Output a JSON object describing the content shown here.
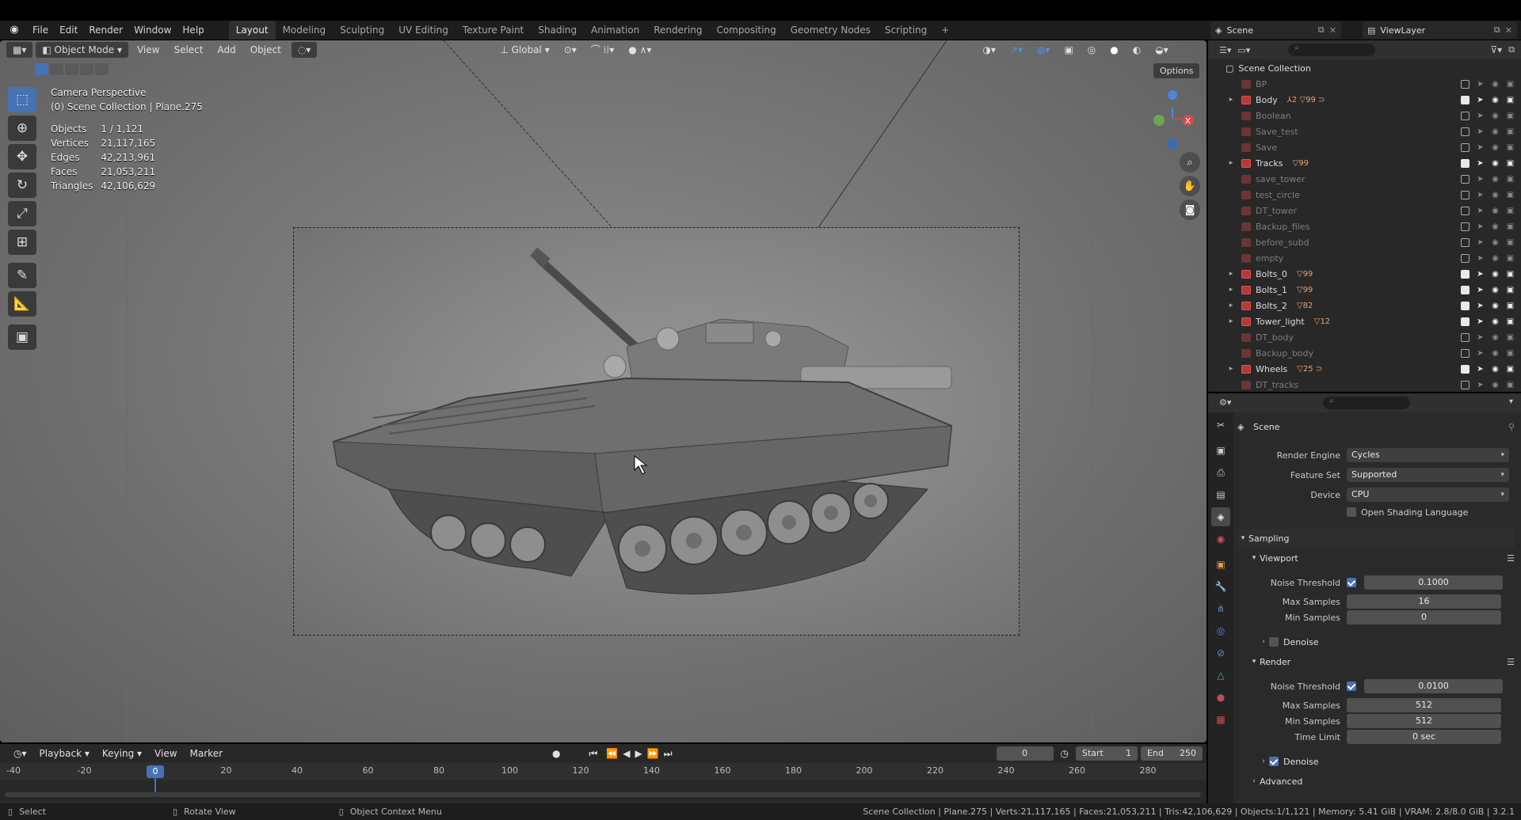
{
  "menubar": {
    "menus": [
      "File",
      "Edit",
      "Render",
      "Window",
      "Help"
    ],
    "workspaces": [
      "Layout",
      "Modeling",
      "Sculpting",
      "UV Editing",
      "Texture Paint",
      "Shading",
      "Animation",
      "Rendering",
      "Compositing",
      "Geometry Nodes",
      "Scripting"
    ],
    "active_workspace": "Layout",
    "add_tab": "+",
    "scene": "Scene",
    "view_layer": "ViewLayer"
  },
  "viewport_header": {
    "mode": "Object Mode",
    "menus": [
      "View",
      "Select",
      "Add",
      "Object"
    ],
    "orientation": "Global",
    "options": "Options"
  },
  "viewport": {
    "view_name": "Camera Perspective",
    "context": "(0) Scene Collection | Plane.275",
    "stats": [
      {
        "label": "Objects",
        "value": "1 / 1,121"
      },
      {
        "label": "Vertices",
        "value": "21,117,165"
      },
      {
        "label": "Edges",
        "value": "42,213,961"
      },
      {
        "label": "Faces",
        "value": "21,053,211"
      },
      {
        "label": "Triangles",
        "value": "42,106,629"
      }
    ]
  },
  "outliner": {
    "root": "Scene Collection",
    "items": [
      {
        "name": "BP",
        "expandable": false,
        "enabled": false,
        "mods": ""
      },
      {
        "name": "Body",
        "expandable": true,
        "enabled": true,
        "mods": "⅄2 ▽99 ⊃"
      },
      {
        "name": "Boolean",
        "expandable": false,
        "enabled": false,
        "mods": ""
      },
      {
        "name": "Save_test",
        "expandable": false,
        "enabled": false,
        "mods": ""
      },
      {
        "name": "Save",
        "expandable": false,
        "enabled": false,
        "mods": ""
      },
      {
        "name": "Tracks",
        "expandable": true,
        "enabled": true,
        "mods": "▽99"
      },
      {
        "name": "save_tower",
        "expandable": false,
        "enabled": false,
        "mods": ""
      },
      {
        "name": "test_circle",
        "expandable": false,
        "enabled": false,
        "mods": ""
      },
      {
        "name": "DT_tower",
        "expandable": false,
        "enabled": false,
        "mods": ""
      },
      {
        "name": "Backup_files",
        "expandable": false,
        "enabled": false,
        "mods": ""
      },
      {
        "name": "before_subd",
        "expandable": false,
        "enabled": false,
        "mods": ""
      },
      {
        "name": "empty",
        "expandable": false,
        "enabled": false,
        "mods": ""
      },
      {
        "name": "Bolts_0",
        "expandable": true,
        "enabled": true,
        "mods": "▽99"
      },
      {
        "name": "Bolts_1",
        "expandable": true,
        "enabled": true,
        "mods": "▽99"
      },
      {
        "name": "Bolts_2",
        "expandable": true,
        "enabled": true,
        "mods": "▽82"
      },
      {
        "name": "Tower_light",
        "expandable": true,
        "enabled": true,
        "mods": "▽12"
      },
      {
        "name": "DT_body",
        "expandable": false,
        "enabled": false,
        "mods": ""
      },
      {
        "name": "Backup_body",
        "expandable": false,
        "enabled": false,
        "mods": ""
      },
      {
        "name": "Wheels",
        "expandable": true,
        "enabled": true,
        "mods": "▽25 ⊃"
      },
      {
        "name": "DT_tracks",
        "expandable": false,
        "enabled": false,
        "mods": ""
      }
    ]
  },
  "properties": {
    "context": "Scene",
    "render_engine": {
      "label": "Render Engine",
      "value": "Cycles"
    },
    "feature_set": {
      "label": "Feature Set",
      "value": "Supported"
    },
    "device": {
      "label": "Device",
      "value": "CPU"
    },
    "osl": "Open Shading Language",
    "sampling": "Sampling",
    "viewport": {
      "title": "Viewport",
      "noise_threshold": {
        "label": "Noise Threshold",
        "value": "0.1000"
      },
      "max_samples": {
        "label": "Max Samples",
        "value": "16"
      },
      "min_samples": {
        "label": "Min Samples",
        "value": "0"
      },
      "denoise": "Denoise"
    },
    "render": {
      "title": "Render",
      "noise_threshold": {
        "label": "Noise Threshold",
        "value": "0.0100"
      },
      "max_samples": {
        "label": "Max Samples",
        "value": "512"
      },
      "min_samples": {
        "label": "Min Samples",
        "value": "512"
      },
      "time_limit": {
        "label": "Time Limit",
        "value": "0 sec"
      },
      "denoise": "Denoise"
    },
    "advanced": "Advanced"
  },
  "timeline": {
    "menus": [
      "Playback",
      "Keying",
      "View",
      "Marker"
    ],
    "current_frame": "0",
    "start_label": "Start",
    "start": "1",
    "end_label": "End",
    "end": "250",
    "ticks": [
      "-40",
      "-20",
      "0",
      "20",
      "40",
      "60",
      "80",
      "100",
      "120",
      "140",
      "160",
      "180",
      "200",
      "220",
      "240",
      "260",
      "280"
    ],
    "current_frame_value": 0
  },
  "statusbar": {
    "select": "Select",
    "rotate": "Rotate View",
    "context_menu": "Object Context Menu",
    "info": "Scene Collection | Plane.275 | Verts:21,117,165 | Faces:21,053,211 | Tris:42,106,629 | Objects:1/1,121 | Memory: 5.41 GiB | VRAM: 2.8/8.0 GiB | 3.2.1"
  },
  "colors": {
    "accent": "#4772b3",
    "collection_red": "#e05050",
    "modifier_orange": "#e8a36a"
  }
}
